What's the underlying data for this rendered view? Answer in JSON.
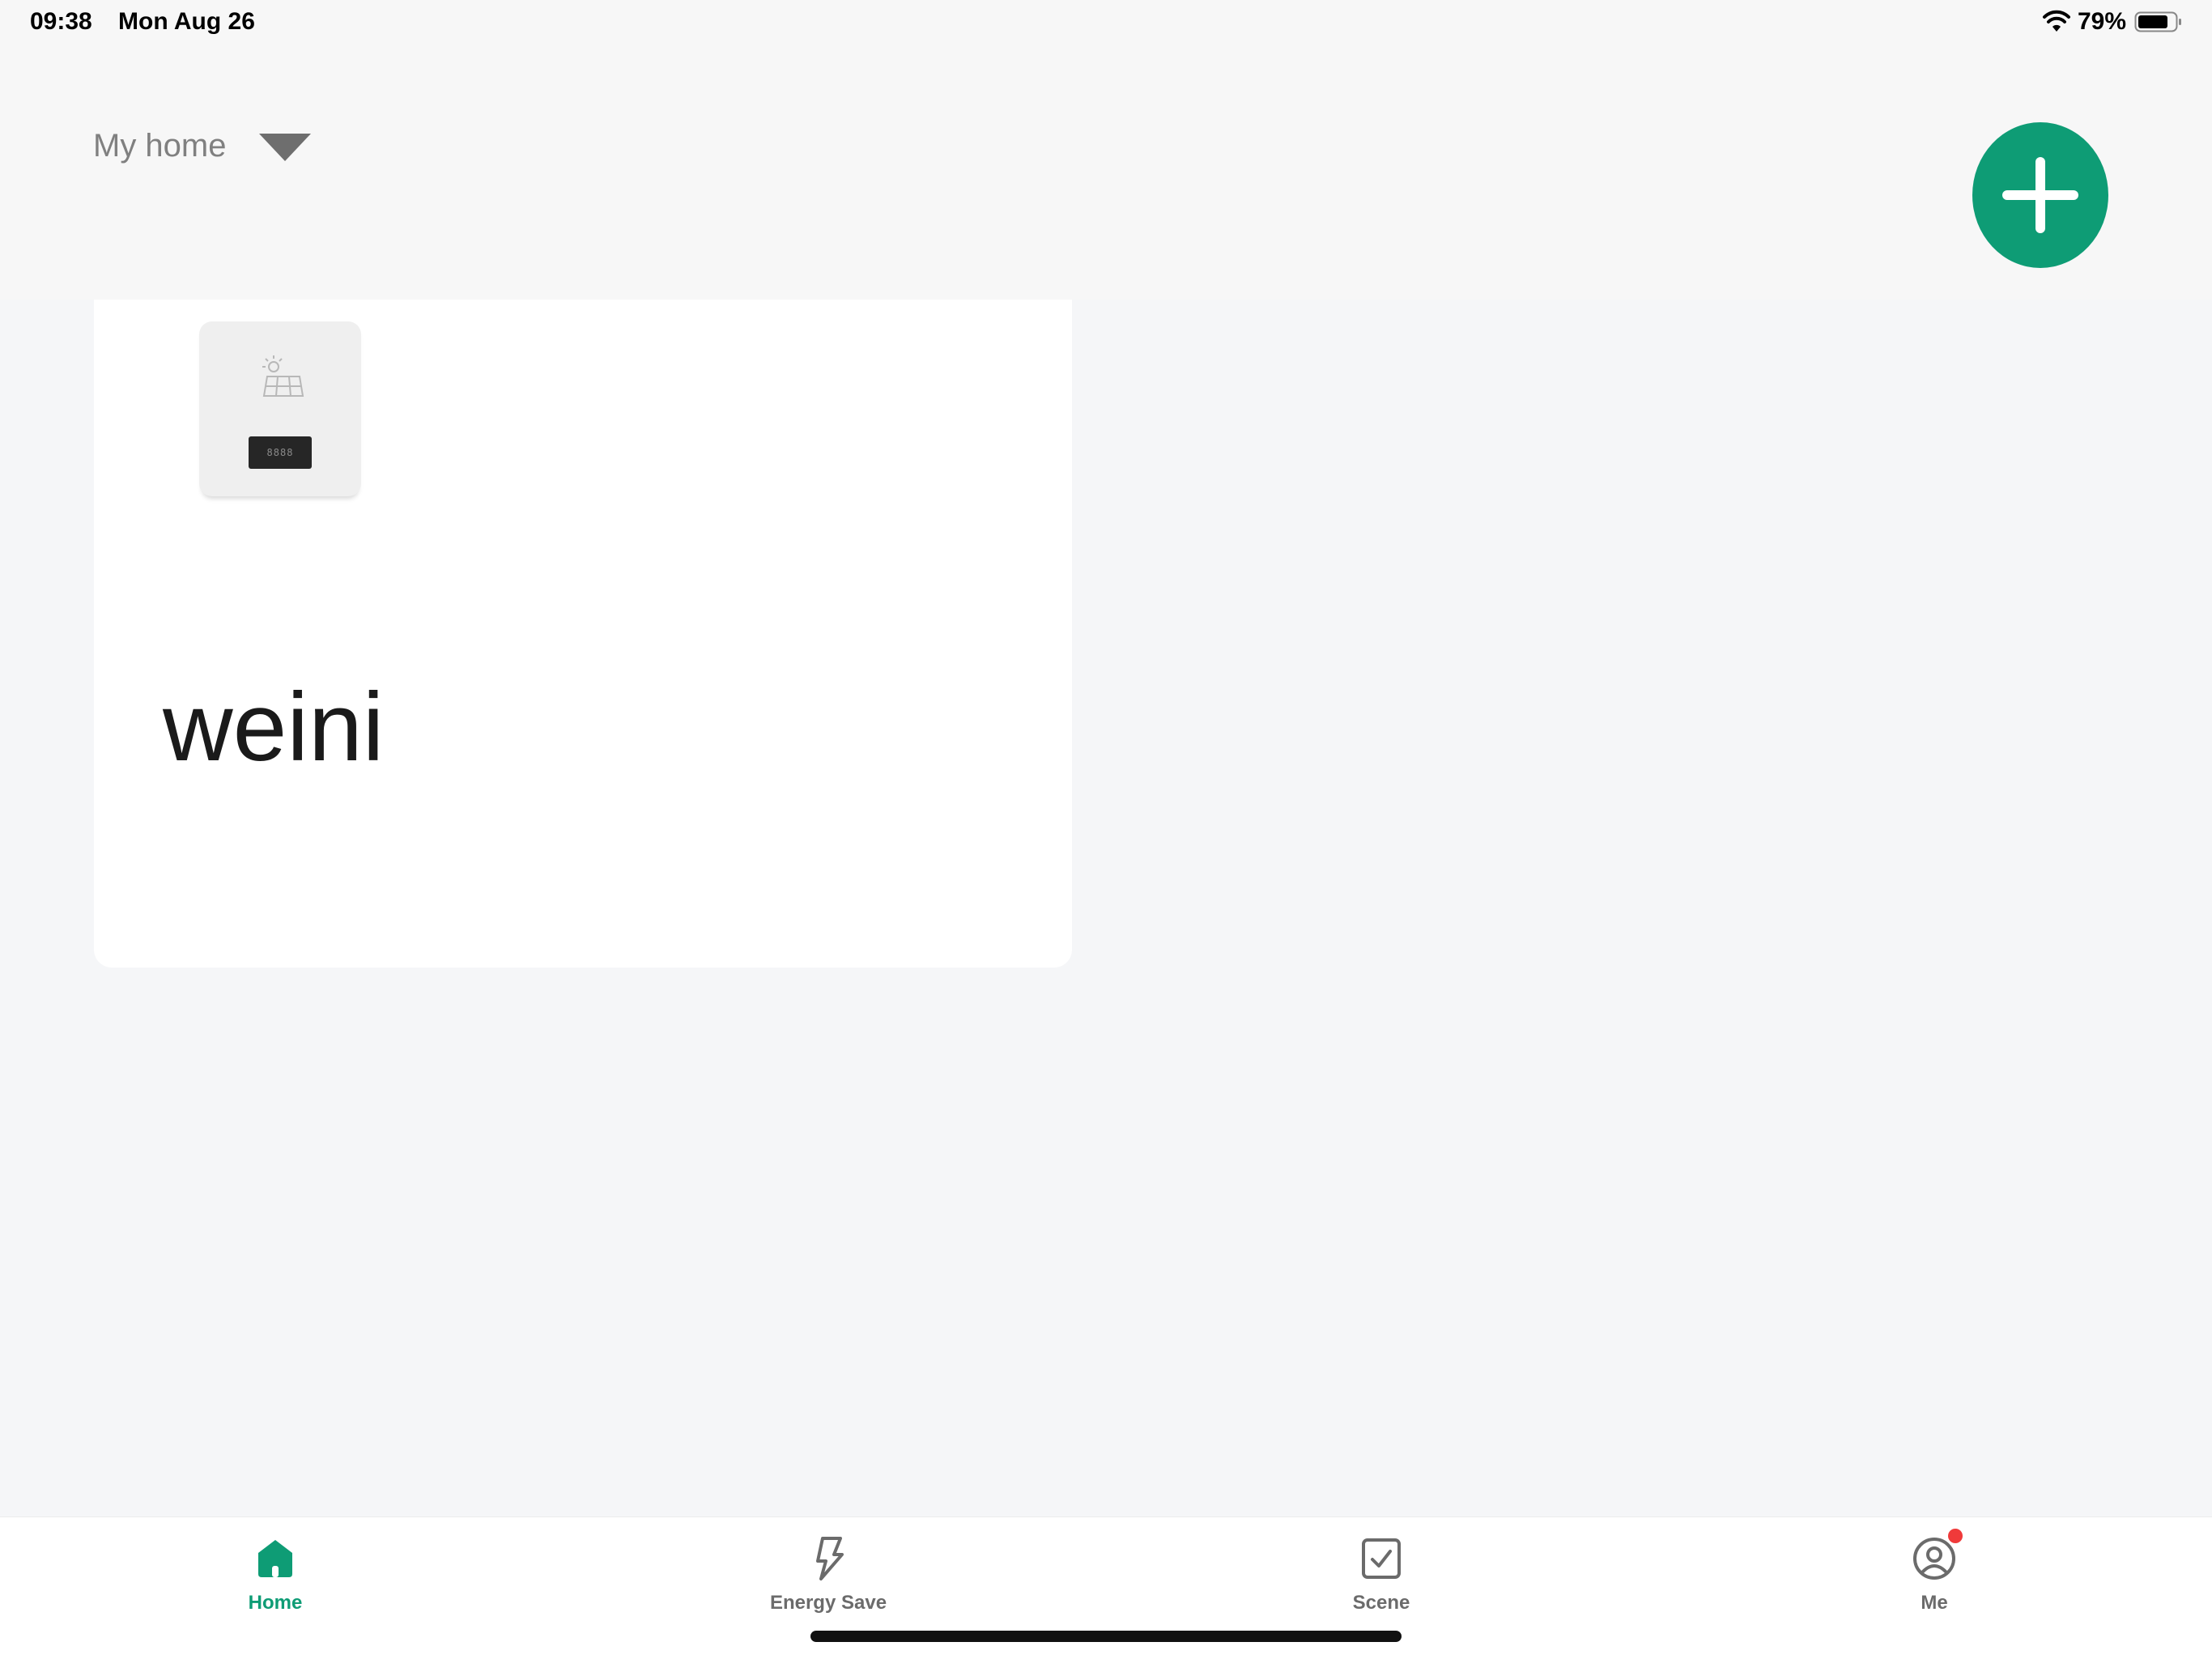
{
  "status_bar": {
    "time": "09:38",
    "date": "Mon Aug 26",
    "battery_percent": "79%",
    "icons": [
      "wifi-icon",
      "battery-icon"
    ]
  },
  "header": {
    "home_name": "My home",
    "dropdown_icon": "caret-down-icon",
    "add_icon": "plus-icon",
    "accent_color": "#0e9c75"
  },
  "device": {
    "name": "weini",
    "display_text": "8888",
    "icon": "solar-panel-icon"
  },
  "tabs": [
    {
      "label": "Home",
      "icon": "home-icon",
      "active": true
    },
    {
      "label": "Energy Save",
      "icon": "lightning-icon",
      "active": false
    },
    {
      "label": "Scene",
      "icon": "checkbox-icon",
      "active": false
    },
    {
      "label": "Me",
      "icon": "user-icon",
      "active": false,
      "has_notification": true
    }
  ],
  "colors": {
    "active_tab": "#0e9c75",
    "inactive_tab": "#6b6b6b",
    "notification": "#f03a3a"
  }
}
